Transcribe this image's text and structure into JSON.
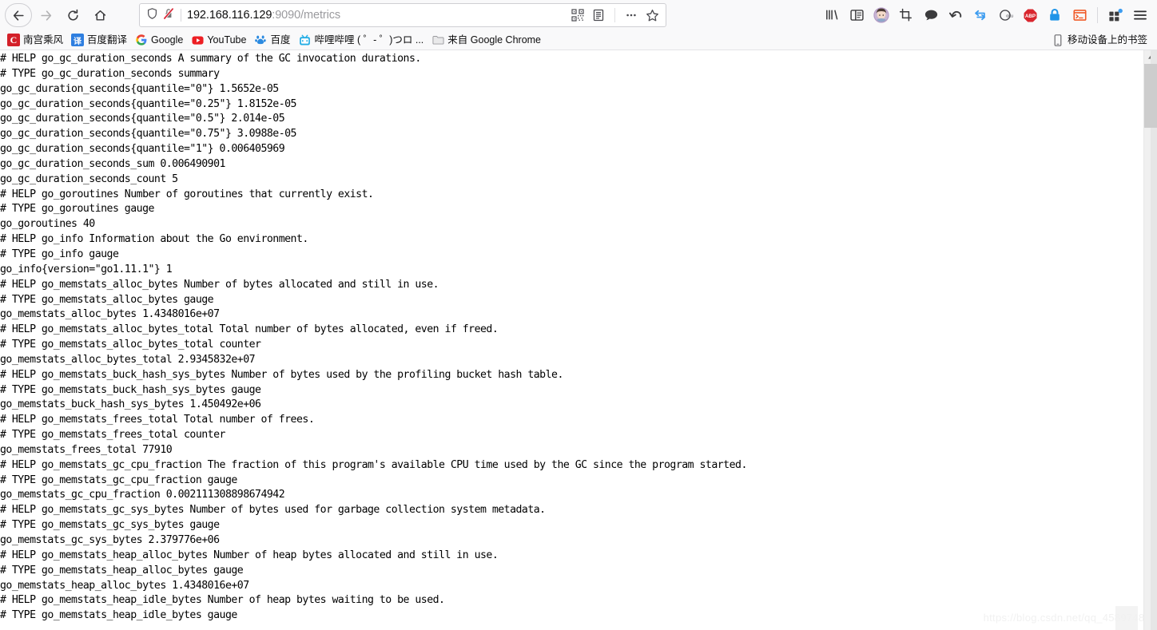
{
  "browser": {
    "nav": {
      "back_label": "Back",
      "forward_label": "Forward",
      "reload_label": "Reload",
      "home_label": "Home"
    },
    "urlbar": {
      "host": "192.168.116.129",
      "rest": ":9090/metrics",
      "full_url": "192.168.116.129:9090/metrics",
      "shield_icon": "tracking-protection-shield-icon",
      "lock_icon": "insecure-connection-crossed-lock-icon",
      "qr_icon": "qr-code-icon",
      "reader_icon": "reader-view-icon",
      "page_actions_icon": "ellipsis-icon",
      "bookmark_icon": "star-icon"
    },
    "toolbar_right": [
      {
        "name": "library-icon",
        "glyph": "library"
      },
      {
        "name": "sidebars-icon",
        "glyph": "sidebar"
      },
      {
        "name": "account-avatar",
        "glyph": "avatar"
      },
      {
        "name": "screenshot-crop-icon",
        "glyph": "crop"
      },
      {
        "name": "chat-bubble-icon",
        "glyph": "bubble"
      },
      {
        "name": "undo-arrow-icon",
        "glyph": "undo"
      },
      {
        "name": "sync-loop-icon",
        "glyph": "loop"
      },
      {
        "name": "goku-extension-icon",
        "glyph": "goku"
      },
      {
        "name": "adblock-plus-icon",
        "glyph": "abp"
      },
      {
        "name": "lock-extension-icon",
        "glyph": "lock"
      },
      {
        "name": "terminal-extension-icon",
        "glyph": "terminal"
      },
      {
        "name": "extensions-gift-icon",
        "glyph": "gift"
      },
      {
        "name": "app-menu-icon",
        "glyph": "hamburger"
      }
    ],
    "bookmarks": [
      {
        "label": "南宫乘风",
        "icon": "csdn-favicon",
        "icon_text": "C"
      },
      {
        "label": "百度翻译",
        "icon": "fanyi-favicon",
        "icon_text": "译"
      },
      {
        "label": "Google",
        "icon": "google-favicon",
        "icon_text": "G"
      },
      {
        "label": "YouTube",
        "icon": "youtube-favicon",
        "icon_text": "▶"
      },
      {
        "label": "百度",
        "icon": "baidu-favicon",
        "icon_text": "熊"
      },
      {
        "label": "哔哩哔哩 ( ゜- ゜)つロ ...",
        "icon": "bilibili-favicon",
        "icon_text": "tv"
      },
      {
        "label": "来自 Google Chrome",
        "icon": "folder-icon",
        "icon_text": "📁"
      }
    ],
    "bookmarks_right": {
      "label": "移动设备上的书签",
      "icon": "mobile-device-icon"
    }
  },
  "page": {
    "watermark": "https://blog.csdn.net/qq_45897480",
    "scrollbar": {
      "up_arrow": "scroll-up-arrow-icon",
      "down_arrow": "scroll-down-arrow-icon"
    },
    "metrics_text": "# HELP go_gc_duration_seconds A summary of the GC invocation durations.\n# TYPE go_gc_duration_seconds summary\ngo_gc_duration_seconds{quantile=\"0\"} 1.5652e-05\ngo_gc_duration_seconds{quantile=\"0.25\"} 1.8152e-05\ngo_gc_duration_seconds{quantile=\"0.5\"} 2.014e-05\ngo_gc_duration_seconds{quantile=\"0.75\"} 3.0988e-05\ngo_gc_duration_seconds{quantile=\"1\"} 0.006405969\ngo_gc_duration_seconds_sum 0.006490901\ngo_gc_duration_seconds_count 5\n# HELP go_goroutines Number of goroutines that currently exist.\n# TYPE go_goroutines gauge\ngo_goroutines 40\n# HELP go_info Information about the Go environment.\n# TYPE go_info gauge\ngo_info{version=\"go1.11.1\"} 1\n# HELP go_memstats_alloc_bytes Number of bytes allocated and still in use.\n# TYPE go_memstats_alloc_bytes gauge\ngo_memstats_alloc_bytes 1.4348016e+07\n# HELP go_memstats_alloc_bytes_total Total number of bytes allocated, even if freed.\n# TYPE go_memstats_alloc_bytes_total counter\ngo_memstats_alloc_bytes_total 2.9345832e+07\n# HELP go_memstats_buck_hash_sys_bytes Number of bytes used by the profiling bucket hash table.\n# TYPE go_memstats_buck_hash_sys_bytes gauge\ngo_memstats_buck_hash_sys_bytes 1.450492e+06\n# HELP go_memstats_frees_total Total number of frees.\n# TYPE go_memstats_frees_total counter\ngo_memstats_frees_total 77910\n# HELP go_memstats_gc_cpu_fraction The fraction of this program's available CPU time used by the GC since the program started.\n# TYPE go_memstats_gc_cpu_fraction gauge\ngo_memstats_gc_cpu_fraction 0.002111308898674942\n# HELP go_memstats_gc_sys_bytes Number of bytes used for garbage collection system metadata.\n# TYPE go_memstats_gc_sys_bytes gauge\ngo_memstats_gc_sys_bytes 2.379776e+06\n# HELP go_memstats_heap_alloc_bytes Number of heap bytes allocated and still in use.\n# TYPE go_memstats_heap_alloc_bytes gauge\ngo_memstats_heap_alloc_bytes 1.4348016e+07\n# HELP go_memstats_heap_idle_bytes Number of heap bytes waiting to be used.\n# TYPE go_memstats_heap_idle_bytes gauge"
  }
}
